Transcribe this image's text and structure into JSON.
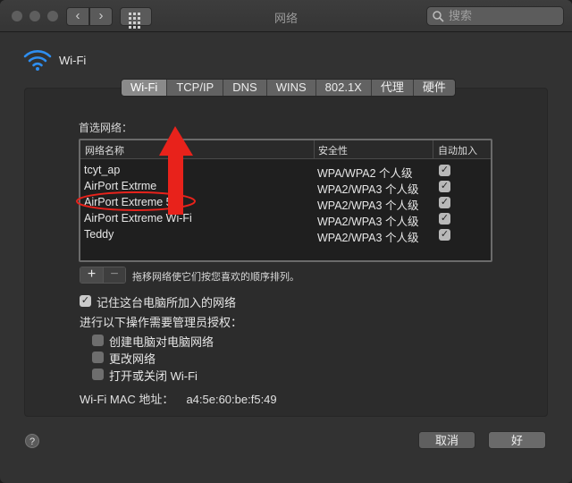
{
  "window": {
    "title": "网络"
  },
  "search": {
    "placeholder": "搜索"
  },
  "nav": {
    "back": "‹",
    "forward": "›"
  },
  "header": {
    "label": "Wi-Fi"
  },
  "tabs": [
    "Wi-Fi",
    "TCP/IP",
    "DNS",
    "WINS",
    "802.1X",
    "代理",
    "硬件"
  ],
  "active_tab": "Wi-Fi",
  "preferred": {
    "label": "首选网络：",
    "columns": {
      "name": "网络名称",
      "security": "安全性",
      "auto_join": "自动加入"
    },
    "rows": [
      {
        "name": "tcyt_ap",
        "security": "WPA/WPA2 个人级",
        "auto_join": true
      },
      {
        "name": "AirPort Extrme",
        "security": "WPA2/WPA3 个人级",
        "auto_join": true
      },
      {
        "name": "AirPort Extreme 5G",
        "security": "WPA2/WPA3 个人级",
        "auto_join": true
      },
      {
        "name": "AirPort Extreme Wi-Fi",
        "security": "WPA2/WPA3 个人级",
        "auto_join": true
      },
      {
        "name": "Teddy",
        "security": "WPA2/WPA3 个人级",
        "auto_join": true
      }
    ]
  },
  "list_controls": {
    "add": "+",
    "remove": "−",
    "hint": "拖移网络使它们按您喜欢的顺序排列。"
  },
  "options": {
    "remember": {
      "label": "记住这台电脑所加入的网络",
      "checked": true
    },
    "admin_heading": "进行以下操作需要管理员授权：",
    "admin_items": [
      {
        "label": "创建电脑对电脑网络",
        "checked": false
      },
      {
        "label": "更改网络",
        "checked": false
      },
      {
        "label": "打开或关闭 Wi-Fi",
        "checked": false
      }
    ]
  },
  "mac": {
    "label": "Wi-Fi MAC 地址：",
    "value": "a4:5e:60:be:f5:49"
  },
  "footer": {
    "help": "?",
    "cancel": "取消",
    "ok": "好"
  },
  "colors": {
    "annotation": "#e8221b",
    "background": "#323232"
  }
}
